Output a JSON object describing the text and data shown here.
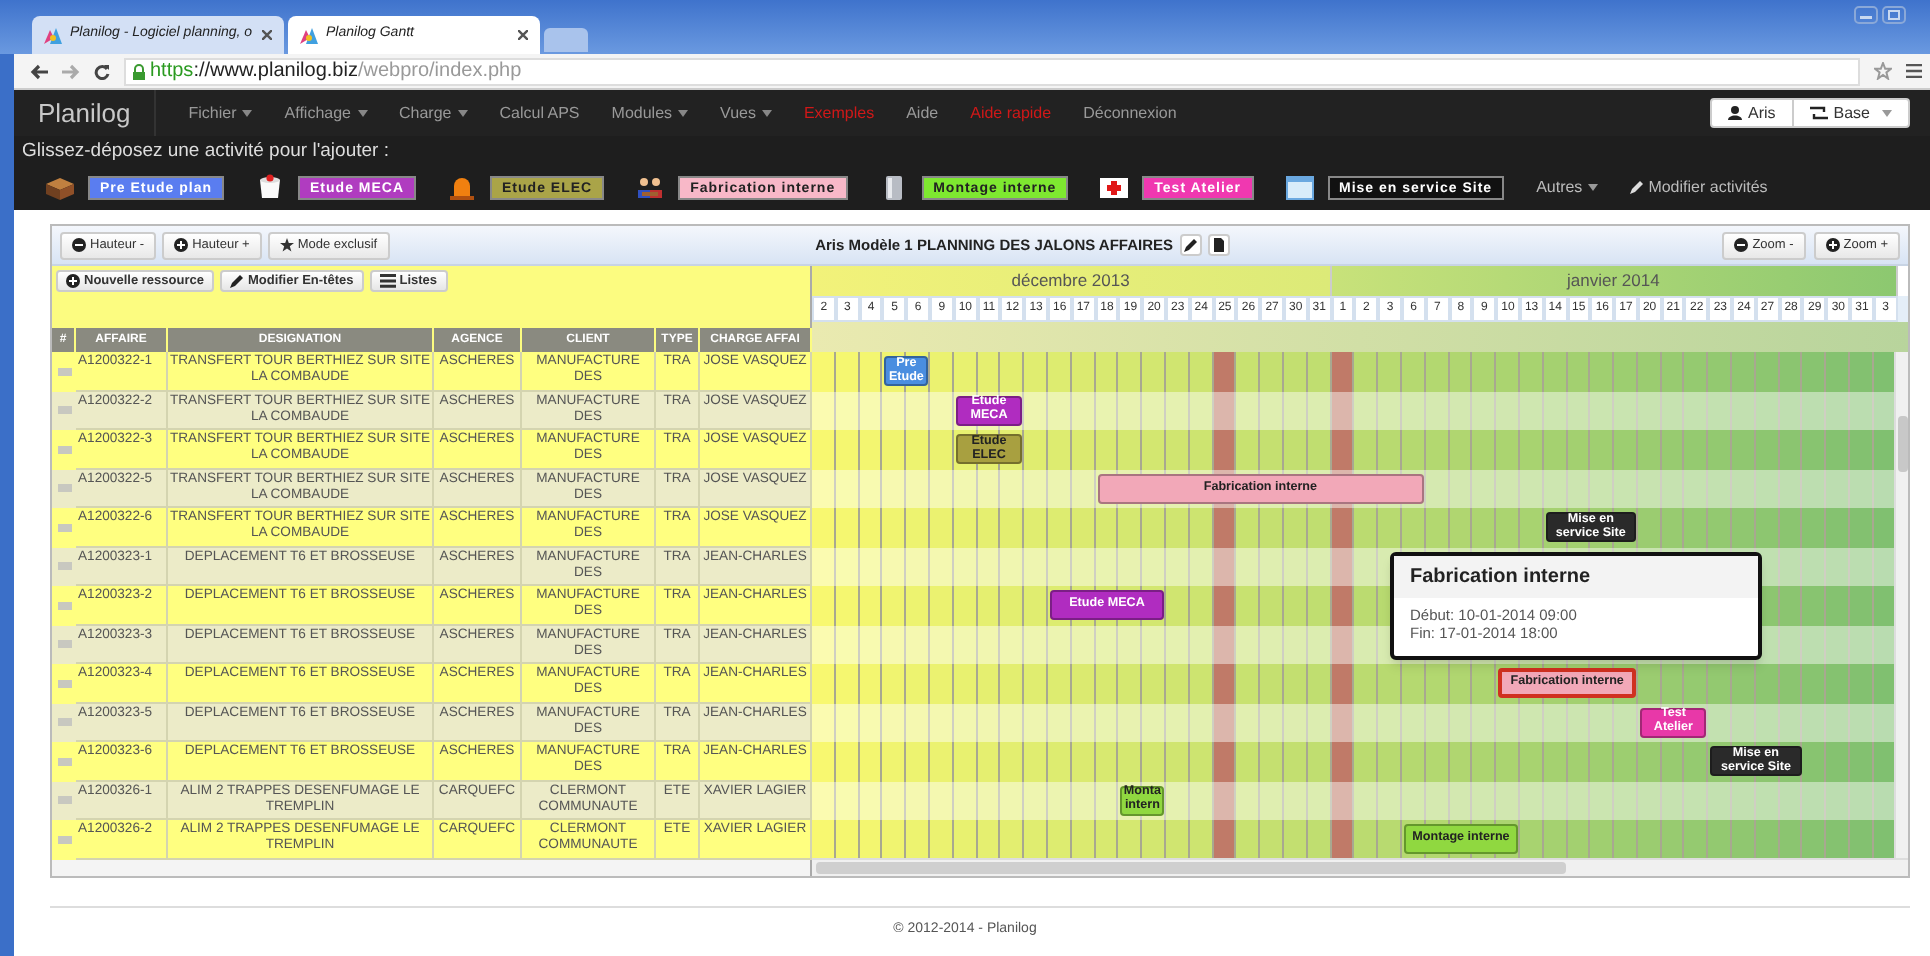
{
  "browser": {
    "tabs": [
      {
        "title": "Planilog - Logiciel planning, o",
        "selected": false
      },
      {
        "title": "Planilog Gantt",
        "selected": true
      }
    ],
    "url": {
      "scheme": "https",
      "host": "://www.planilog.biz",
      "path": "/webpro/index.php"
    }
  },
  "menu": {
    "brand": "Planilog",
    "items": [
      {
        "label": "Fichier",
        "kind": "dropdown"
      },
      {
        "label": "Affichage",
        "kind": "dropdown"
      },
      {
        "label": "Charge",
        "kind": "dropdown"
      },
      {
        "label": "Calcul APS",
        "kind": "link"
      },
      {
        "label": "Modules",
        "kind": "dropdown"
      },
      {
        "label": "Vues",
        "kind": "dropdown"
      },
      {
        "label": "Exemples",
        "kind": "highlight"
      },
      {
        "label": "Aide",
        "kind": "link"
      },
      {
        "label": "Aide rapide",
        "kind": "highlight"
      },
      {
        "label": "Déconnexion",
        "kind": "link"
      }
    ],
    "user_buttons": [
      {
        "label": "Aris",
        "kind": "user"
      },
      {
        "label": "Base",
        "kind": "dropdown"
      }
    ]
  },
  "palette": {
    "hint": "Glissez-déposez une activité pour l'ajouter :",
    "activities": [
      {
        "label": "Pre Etude plan",
        "color": "#5a7df0"
      },
      {
        "label": "Etude MECA",
        "color": "#b03cc0"
      },
      {
        "label": "Etude ELEC",
        "color": "#aaa448"
      },
      {
        "label": "Fabrication interne",
        "color": "#f8b8c8"
      },
      {
        "label": "Montage interne",
        "color": "#7ee830"
      },
      {
        "label": "Test Atelier",
        "color": "#f038b0"
      },
      {
        "label": "Mise en service Site",
        "color": "#111111"
      }
    ],
    "others": "Autres",
    "edit": "Modifier activités"
  },
  "toolbar": {
    "left": [
      {
        "label": "Hauteur -",
        "kind": "minus"
      },
      {
        "label": "Hauteur +",
        "kind": "plus"
      },
      {
        "label": "Mode exclusif",
        "kind": "star"
      }
    ],
    "title": "Aris Modèle 1 PLANNING DES JALONS AFFAIRES",
    "right": [
      {
        "label": "Zoom -",
        "kind": "minus"
      },
      {
        "label": "Zoom +",
        "kind": "plus"
      }
    ]
  },
  "table": {
    "buttons": [
      {
        "label": "Nouvelle ressource",
        "kind": "plus"
      },
      {
        "label": "Modifier En-têtes",
        "kind": "pencil"
      },
      {
        "label": "Listes",
        "kind": "list"
      }
    ],
    "columns": [
      "#",
      "AFFAIRE",
      "DESIGNATION",
      "AGENCE",
      "CLIENT",
      "TYPE",
      "CHARGE AFFAI"
    ],
    "rows": [
      {
        "cells": [
          "",
          "A1200322-1",
          "TRANSFERT TOUR BERTHIEZ SUR SITE LA COMBAUDE",
          "ASCHERES",
          "MANUFACTURE DES",
          "TRA",
          "JOSE VASQUEZ"
        ],
        "bars": [
          {
            "label": "Pre Etude",
            "color": "#4a8ee0",
            "selected": false
          }
        ]
      },
      {
        "cells": [
          "",
          "A1200322-2",
          "TRANSFERT TOUR BERTHIEZ SUR SITE LA COMBAUDE",
          "ASCHERES",
          "MANUFACTURE DES",
          "TRA",
          "JOSE VASQUEZ"
        ],
        "bars": [
          {
            "label": "Etude MECA",
            "color": "#b02cc0",
            "selected": false
          }
        ]
      },
      {
        "cells": [
          "",
          "A1200322-3",
          "TRANSFERT TOUR BERTHIEZ SUR SITE LA COMBAUDE",
          "ASCHERES",
          "MANUFACTURE DES",
          "TRA",
          "JOSE VASQUEZ"
        ],
        "bars": [
          {
            "label": "Etude ELEC",
            "color": "#a8a040",
            "selected": false
          }
        ]
      },
      {
        "cells": [
          "",
          "A1200322-5",
          "TRANSFERT TOUR BERTHIEZ SUR SITE LA COMBAUDE",
          "ASCHERES",
          "MANUFACTURE DES",
          "TRA",
          "JOSE VASQUEZ"
        ],
        "bars": [
          {
            "label": "Fabrication interne",
            "color": "#f2a8b8",
            "selected": false
          }
        ]
      },
      {
        "cells": [
          "",
          "A1200322-6",
          "TRANSFERT TOUR BERTHIEZ SUR SITE LA COMBAUDE",
          "ASCHERES",
          "MANUFACTURE DES",
          "TRA",
          "JOSE VASQUEZ"
        ],
        "bars": [
          {
            "label": "Mise en service Site",
            "color": "#2a2a2a",
            "selected": false
          }
        ]
      },
      {
        "cells": [
          "",
          "A1200323-1",
          "DEPLACEMENT T6 ET BROSSEUSE",
          "ASCHERES",
          "MANUFACTURE DES",
          "TRA",
          "JEAN-CHARLES"
        ]
      },
      {
        "cells": [
          "",
          "A1200323-2",
          "DEPLACEMENT T6 ET BROSSEUSE",
          "ASCHERES",
          "MANUFACTURE DES",
          "TRA",
          "JEAN-CHARLES"
        ],
        "bars": [
          {
            "label": "Etude MECA",
            "color": "#b02cc0",
            "selected": false
          }
        ]
      },
      {
        "cells": [
          "",
          "A1200323-3",
          "DEPLACEMENT T6 ET BROSSEUSE",
          "ASCHERES",
          "MANUFACTURE DES",
          "TRA",
          "JEAN-CHARLES"
        ]
      },
      {
        "cells": [
          "",
          "A1200323-4",
          "DEPLACEMENT T6 ET BROSSEUSE",
          "ASCHERES",
          "MANUFACTURE DES",
          "TRA",
          "JEAN-CHARLES"
        ],
        "bars": [
          {
            "label": "Fabrication interne",
            "color": "#f2a8b8",
            "selected": true
          }
        ]
      },
      {
        "cells": [
          "",
          "A1200323-5",
          "DEPLACEMENT T6 ET BROSSEUSE",
          "ASCHERES",
          "MANUFACTURE DES",
          "TRA",
          "JEAN-CHARLES"
        ],
        "bars": [
          {
            "label": "Test Atelier",
            "color": "#e838a8",
            "selected": false
          }
        ]
      },
      {
        "cells": [
          "",
          "A1200323-6",
          "DEPLACEMENT T6 ET BROSSEUSE",
          "ASCHERES",
          "MANUFACTURE DES",
          "TRA",
          "JEAN-CHARLES"
        ],
        "bars": [
          {
            "label": "Mise en service Site",
            "color": "#2a2a2a",
            "selected": false
          }
        ]
      },
      {
        "cells": [
          "",
          "A1200326-1",
          "ALIM 2 TRAPPES DESENFUMAGE LE TREMPLIN",
          "CARQUEFC",
          "CLERMONT COMMUNAUTE",
          "ETE",
          "XAVIER LAGIER"
        ],
        "bars": [
          {
            "label": "Monta intern",
            "color": "#90d840",
            "selected": false
          }
        ]
      },
      {
        "cells": [
          "",
          "A1200326-2",
          "ALIM 2 TRAPPES DESENFUMAGE LE TREMPLIN",
          "CARQUEFC",
          "CLERMONT COMMUNAUTE",
          "ETE",
          "XAVIER LAGIER"
        ],
        "bars": [
          {
            "label": "Montage interne",
            "color": "#90d840",
            "selected": false
          }
        ]
      }
    ]
  },
  "gantt": {
    "months": [
      {
        "label": "décembre 2013",
        "days": [
          {
            "label": "2",
            "holiday": false
          },
          {
            "label": "3",
            "holiday": false
          },
          {
            "label": "4",
            "holiday": false
          },
          {
            "label": "5",
            "holiday": false
          },
          {
            "label": "6",
            "holiday": false
          },
          {
            "label": "9",
            "holiday": false
          },
          {
            "label": "10",
            "holiday": false
          },
          {
            "label": "11",
            "holiday": false
          },
          {
            "label": "12",
            "holiday": false
          },
          {
            "label": "13",
            "holiday": false
          },
          {
            "label": "16",
            "holiday": false
          },
          {
            "label": "17",
            "holiday": false
          },
          {
            "label": "18",
            "holiday": false
          },
          {
            "label": "19",
            "holiday": false
          },
          {
            "label": "20",
            "holiday": false
          },
          {
            "label": "23",
            "holiday": false
          },
          {
            "label": "24",
            "holiday": false
          },
          {
            "label": "25",
            "holiday": true
          },
          {
            "label": "26",
            "holiday": false
          },
          {
            "label": "27",
            "holiday": false
          },
          {
            "label": "30",
            "holiday": false
          },
          {
            "label": "31",
            "holiday": false
          }
        ]
      },
      {
        "label": "janvier 2014",
        "days": [
          {
            "label": "1",
            "holiday": true
          },
          {
            "label": "2",
            "holiday": false
          },
          {
            "label": "3",
            "holiday": false
          },
          {
            "label": "6",
            "holiday": false
          },
          {
            "label": "7",
            "holiday": false
          },
          {
            "label": "8",
            "holiday": false
          },
          {
            "label": "9",
            "holiday": false
          },
          {
            "label": "10",
            "holiday": false
          },
          {
            "label": "13",
            "holiday": false
          },
          {
            "label": "14",
            "holiday": false
          },
          {
            "label": "15",
            "holiday": false
          },
          {
            "label": "16",
            "holiday": false
          },
          {
            "label": "17",
            "holiday": false
          },
          {
            "label": "20",
            "holiday": false
          },
          {
            "label": "21",
            "holiday": false
          },
          {
            "label": "22",
            "holiday": false
          },
          {
            "label": "23",
            "holiday": false
          },
          {
            "label": "24",
            "holiday": false
          },
          {
            "label": "27",
            "holiday": false
          },
          {
            "label": "28",
            "holiday": false
          },
          {
            "label": "29",
            "holiday": false
          },
          {
            "label": "30",
            "holiday": false
          },
          {
            "label": "31",
            "holiday": false
          },
          {
            "label": "3",
            "holiday": false
          }
        ]
      }
    ],
    "tooltip": {
      "title": "Fabrication interne",
      "lines": [
        "Début: 10-01-2014 09:00",
        "Fin: 17-01-2014 18:00"
      ]
    }
  },
  "footer": "© 2012-2014 - Planilog"
}
